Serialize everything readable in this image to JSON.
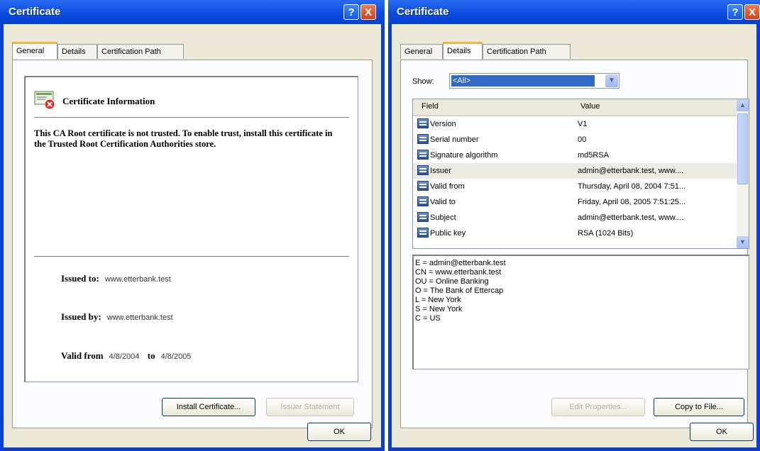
{
  "left": {
    "title": "Certificate",
    "help": "?",
    "close": "X",
    "tabs": [
      "General",
      "Details",
      "Certification Path"
    ],
    "heading": "Certificate Information",
    "message": "This CA Root certificate is not trusted. To enable trust, install this certificate in the Trusted Root Certification Authorities store.",
    "issued_to_label": "Issued to:",
    "issued_to": "www.etterbank.test",
    "issued_by_label": "Issued by:",
    "issued_by": "www.etterbank.test",
    "valid_from_label": "Valid from",
    "valid_from": "4/8/2004",
    "to_label": "to",
    "valid_to": "4/8/2005",
    "install_button": "Install Certificate...",
    "issuer_button": "Issuer Statement",
    "ok": "OK",
    "icon": "certificate-untrusted-icon"
  },
  "right": {
    "title": "Certificate",
    "help": "?",
    "close": "X",
    "tabs": [
      "General",
      "Details",
      "Certification Path"
    ],
    "show_label": "Show:",
    "show_value": "<All>",
    "columns": [
      "Field",
      "Value"
    ],
    "rows": [
      {
        "field": "Version",
        "value": "V1"
      },
      {
        "field": "Serial number",
        "value": "00"
      },
      {
        "field": "Signature algorithm",
        "value": "md5RSA"
      },
      {
        "field": "Issuer",
        "value": "admin@etterbank.test, www...."
      },
      {
        "field": "Valid from",
        "value": "Thursday, April 08, 2004 7:51..."
      },
      {
        "field": "Valid to",
        "value": "Friday, April 08, 2005 7:51:25..."
      },
      {
        "field": "Subject",
        "value": "admin@etterbank.test, www...."
      },
      {
        "field": "Public key",
        "value": "RSA (1024 Bits)"
      }
    ],
    "selected_row": 3,
    "details": [
      "E = admin@etterbank.test",
      "CN = www.etterbank.test",
      "OU = Online Banking",
      "O = The Bank of Ettercap",
      "L = New York",
      "S = New York",
      "C = US"
    ],
    "edit_button": "Edit Properties...",
    "copy_button": "Copy to File...",
    "ok": "OK"
  },
  "colors": {
    "titlebar": "#0a4ce0",
    "dialog": "#ece9d8",
    "selection": "#316ac5",
    "active_tab_accent": "#f9b23e",
    "close_red": "#d2421b"
  }
}
